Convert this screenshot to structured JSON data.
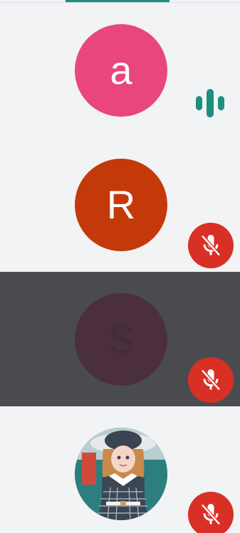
{
  "colors": {
    "accent": "#1e8e7e",
    "tile_bg": "#f1f3f4",
    "tile_dimmed_bg": "#4a4b4f",
    "mute_red": "#d93025"
  },
  "participants": [
    {
      "initial": "a",
      "avatar_color": "#e8467c",
      "status": "speaking",
      "status_icon": "audio-level-icon",
      "dimmed": false
    },
    {
      "initial": "R",
      "avatar_color": "#c4390a",
      "status": "muted",
      "status_icon": "mic-off-icon",
      "dimmed": false
    },
    {
      "initial": "S",
      "avatar_color": "#7a3c56",
      "status": "muted",
      "status_icon": "mic-off-icon",
      "dimmed": true
    },
    {
      "initial": "",
      "avatar_type": "photo",
      "status": "muted",
      "status_icon": "mic-off-icon",
      "dimmed": false
    }
  ]
}
